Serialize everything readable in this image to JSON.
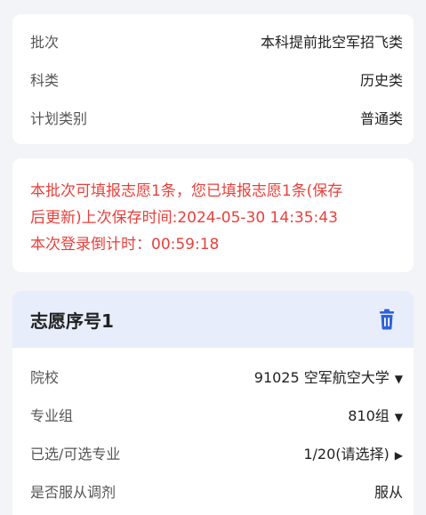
{
  "info": {
    "batch_label": "批次",
    "batch_value": "本科提前批空军招飞类",
    "subject_label": "科类",
    "subject_value": "历史类",
    "plan_label": "计划类别",
    "plan_value": "普通类"
  },
  "notice": {
    "line1": "本批次可填报志愿1条，您已填报志愿1条(保存",
    "line2": "后更新)上次保存时间:2024-05-30 14:35:43",
    "line3": "本次登录倒计时：00:59:18"
  },
  "choice": {
    "title": "志愿序号1",
    "school_label": "院校",
    "school_value": "91025 空军航空大学",
    "group_label": "专业组",
    "group_value": "810组",
    "major_label": "已选/可选专业",
    "major_value": "1/20(请选择)",
    "adjust_label": "是否服从调剂",
    "adjust_value": "服从"
  },
  "icons": {
    "delete": "trash-icon",
    "dropdown": "caret-down-icon",
    "forward": "caret-right-icon"
  },
  "colors": {
    "notice_red": "#e8413b",
    "link_blue": "#2c63d9",
    "link_cyan": "#3aa9d3",
    "header_bg": "#e7edfb"
  }
}
